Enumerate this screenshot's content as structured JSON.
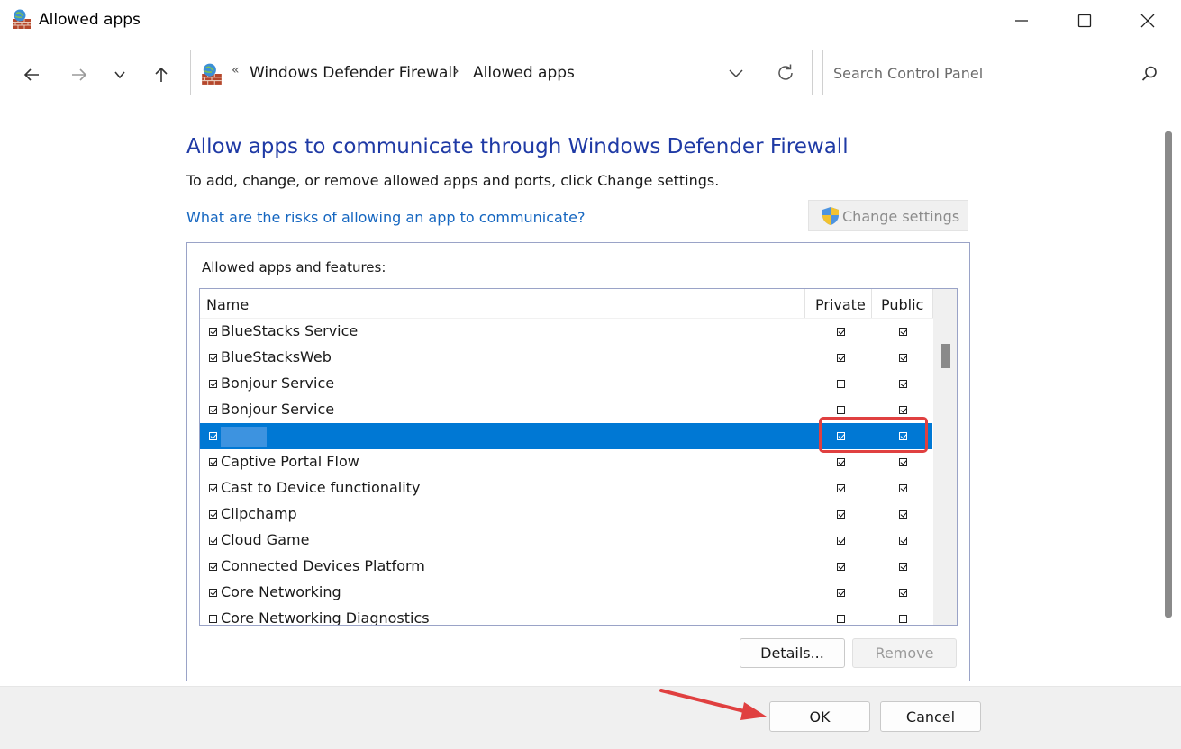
{
  "window": {
    "title": "Allowed apps",
    "controls": [
      "minimize-icon",
      "maximize-icon",
      "close-icon"
    ]
  },
  "nav": {
    "buttons": [
      "back-arrow-icon",
      "forward-arrow-icon",
      "recent-dropdown-icon",
      "up-arrow-icon"
    ]
  },
  "address": {
    "overflow": "«",
    "crumbs": [
      "Windows Defender Firewall",
      "Allowed apps"
    ],
    "separator": "›"
  },
  "search": {
    "placeholder": "Search Control Panel"
  },
  "main": {
    "heading": "Allow apps to communicate through Windows Defender Firewall",
    "description": "To add, change, or remove allowed apps and ports, click Change settings.",
    "risk_link": "What are the risks of allowing an app to communicate?",
    "change_settings": "Change settings"
  },
  "apps": {
    "group_label": "Allowed apps and features:",
    "columns": {
      "name": "Name",
      "private": "Private",
      "public": "Public"
    },
    "rows": [
      {
        "name": "BlueStacks Service",
        "enabled": true,
        "private": true,
        "public": true
      },
      {
        "name": "BlueStacksWeb",
        "enabled": true,
        "private": true,
        "public": true
      },
      {
        "name": "Bonjour Service",
        "enabled": true,
        "private": false,
        "public": true
      },
      {
        "name": "Bonjour Service",
        "enabled": true,
        "private": false,
        "public": true
      },
      {
        "name": "",
        "enabled": true,
        "private": true,
        "public": true,
        "selected": true
      },
      {
        "name": "Captive Portal Flow",
        "enabled": true,
        "private": true,
        "public": true
      },
      {
        "name": "Cast to Device functionality",
        "enabled": true,
        "private": true,
        "public": true
      },
      {
        "name": "Clipchamp",
        "enabled": true,
        "private": true,
        "public": true
      },
      {
        "name": "Cloud Game",
        "enabled": true,
        "private": true,
        "public": true
      },
      {
        "name": "Connected Devices Platform",
        "enabled": true,
        "private": true,
        "public": true
      },
      {
        "name": "Core Networking",
        "enabled": true,
        "private": true,
        "public": true
      },
      {
        "name": "Core Networking Diagnostics",
        "enabled": false,
        "private": false,
        "public": false
      }
    ],
    "details_button": "Details...",
    "remove_button": "Remove"
  },
  "footer": {
    "ok": "OK",
    "cancel": "Cancel"
  },
  "colors": {
    "heading": "#1f3aa5",
    "link": "#1566c0",
    "selection": "#0078d4",
    "annotation": "#e04040"
  }
}
